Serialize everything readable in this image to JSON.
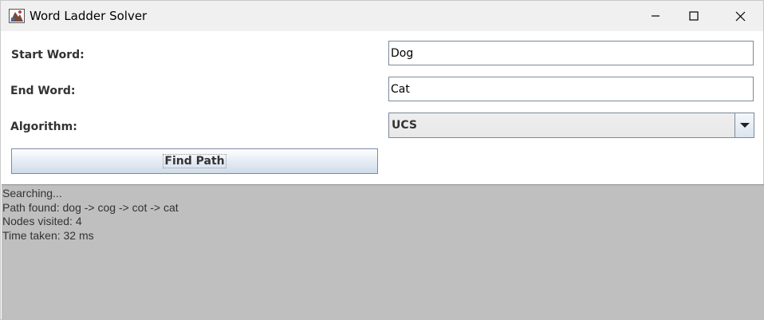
{
  "window": {
    "title": "Word Ladder Solver",
    "app_icon": "java-app-icon"
  },
  "form": {
    "start_label": "Start Word:",
    "start_value": "Dog",
    "end_label": "End Word:",
    "end_value": "Cat",
    "algorithm_label": "Algorithm:",
    "algorithm_value": "UCS"
  },
  "actions": {
    "find_label": "Find Path"
  },
  "output": {
    "lines": [
      "Searching...",
      "Path found: dog -> cog -> cot -> cat",
      "Nodes visited: 4",
      "Time taken: 32 ms"
    ]
  },
  "colors": {
    "titlebar_bg": "#f0f0f0",
    "output_bg": "#bfbfbf",
    "border": "#7a8a9a"
  }
}
